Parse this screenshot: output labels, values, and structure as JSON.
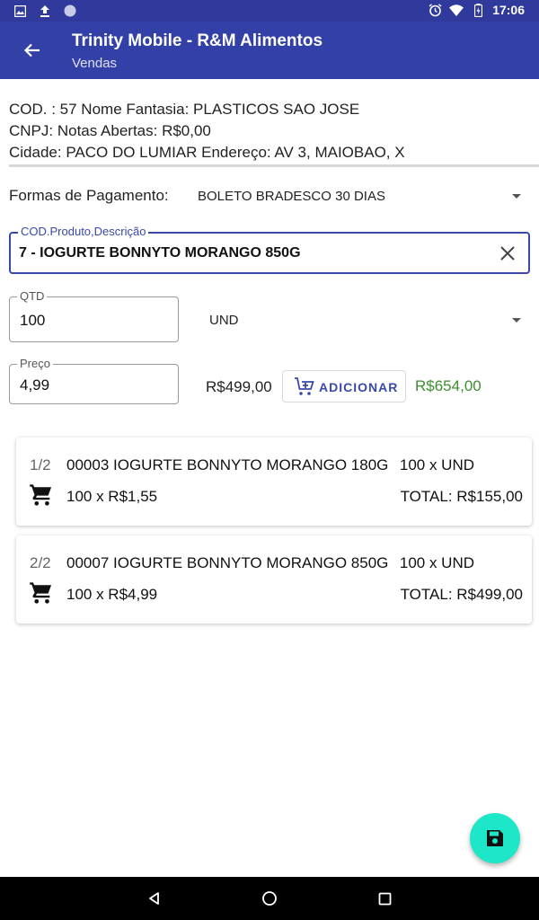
{
  "status_bar": {
    "time": "17:06"
  },
  "app_bar": {
    "title": "Trinity Mobile - R&M Alimentos",
    "subtitle": "Vendas"
  },
  "client": {
    "line1": "COD. : 57  Nome Fantasia: PLASTICOS SAO JOSE",
    "line2": "CNPJ:   Notas Abertas: R$0,00",
    "line3": "Cidade: PACO DO LUMIAR Endereço: AV 3, MAIOBAO, X"
  },
  "payment": {
    "label": "Formas de Pagamento:",
    "value": "BOLETO BRADESCO 30 DIAS"
  },
  "product_field": {
    "label": "COD.Produto,Descrição",
    "value": "7 - IOGURTE BONNYTO MORANGO 850G"
  },
  "qty_field": {
    "label": "QTD",
    "value": "100"
  },
  "unit_select": {
    "value": "UND"
  },
  "price_field": {
    "label": "Preço",
    "value": "4,99"
  },
  "subtotal": "R$499,00",
  "add_button": {
    "label": "ADICIONAR"
  },
  "grand_total": "R$654,00",
  "items": [
    {
      "index": "1/2",
      "name": "00003 IOGURTE BONNYTO MORANGO 180G",
      "qty_unit": "100 x UND",
      "qty_price": "100 x R$1,55",
      "total": "TOTAL: R$155,00"
    },
    {
      "index": "2/2",
      "name": "00007 IOGURTE BONNYTO MORANGO 850G",
      "qty_unit": "100 x UND",
      "qty_price": "100 x R$4,99",
      "total": "TOTAL: R$499,00"
    }
  ],
  "colors": {
    "app_bar": "#3340a8",
    "status_bar": "#2f3a9c",
    "accent": "#3949ab",
    "fab": "#1ee6c8",
    "total_green": "#3e8e2f"
  },
  "icons": {
    "back": "arrow-left-icon",
    "clear": "close-icon",
    "add": "cart-plus-icon",
    "cart": "cart-icon",
    "save": "save-icon"
  }
}
